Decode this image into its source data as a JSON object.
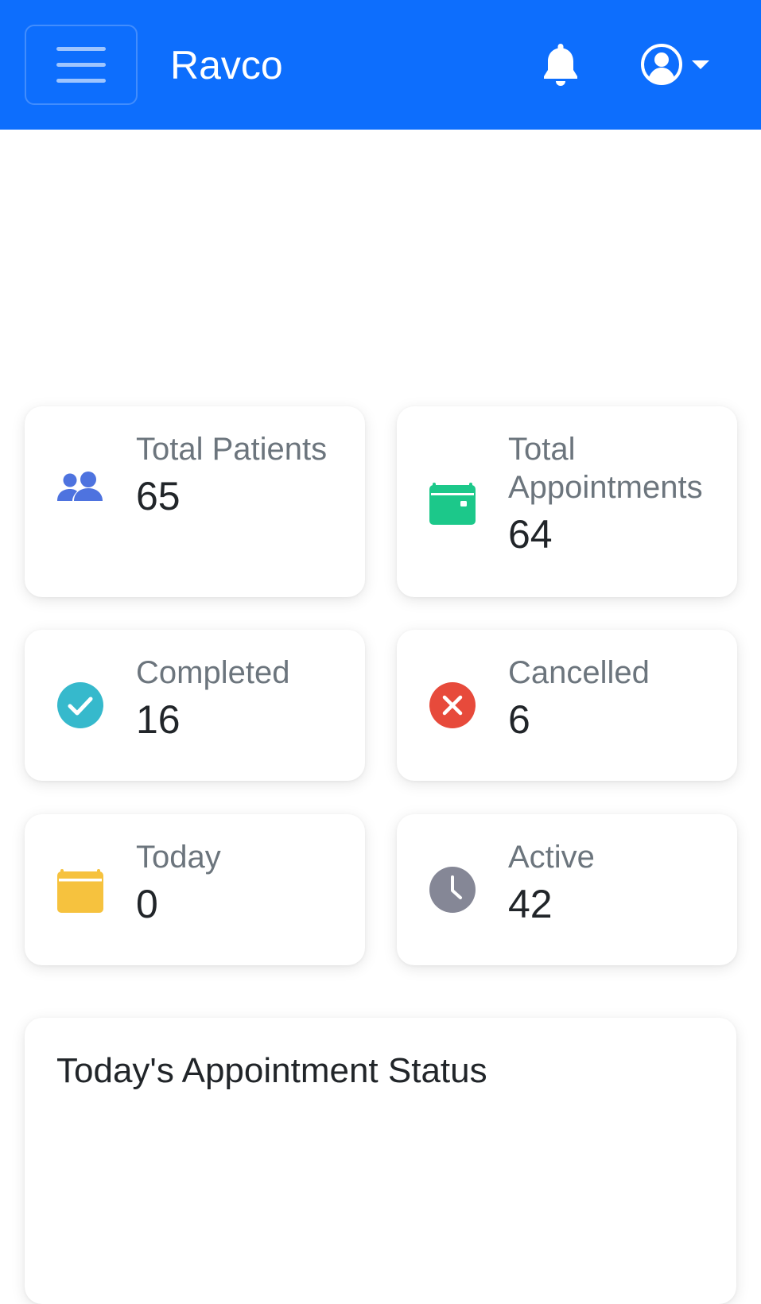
{
  "header": {
    "brand": "Ravco",
    "menu_icon": "hamburger-menu-icon",
    "notification_icon": "bell-icon",
    "user_icon": "user-circle-icon",
    "dropdown_icon": "caret-down-icon",
    "background_color": "#0d6efd"
  },
  "stats": [
    {
      "label": "Total Patients",
      "value": "65",
      "icon": "users-icon",
      "color": "#4e73df"
    },
    {
      "label": "Total Appointments",
      "value": "64",
      "icon": "calendar-icon",
      "color": "#1cc88a"
    },
    {
      "label": "Completed",
      "value": "16",
      "icon": "check-circle-icon",
      "color": "#36b9cc"
    },
    {
      "label": "Cancelled",
      "value": "6",
      "icon": "times-circle-icon",
      "color": "#e74a3b"
    },
    {
      "label": "Today",
      "value": "0",
      "icon": "calendar-day-icon",
      "color": "#f6c23e"
    },
    {
      "label": "Active",
      "value": "42",
      "icon": "clock-icon",
      "color": "#858796"
    }
  ],
  "status_section": {
    "title": "Today's Appointment Status"
  }
}
